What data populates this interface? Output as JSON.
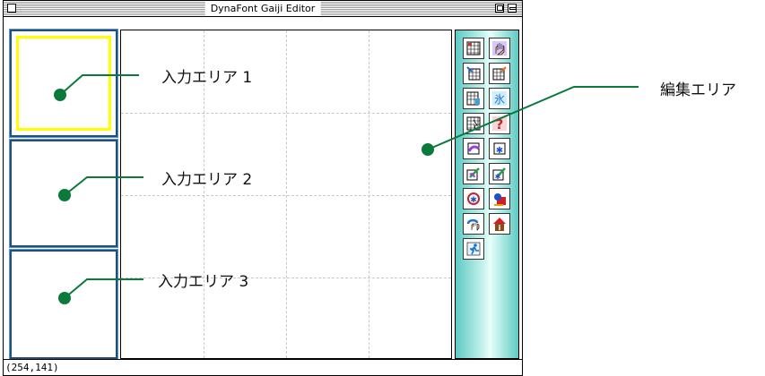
{
  "window": {
    "title": "DynaFont Gaiji Editor"
  },
  "status": {
    "coordinates": "(254,141)"
  },
  "callouts": {
    "input1": "入力エリア 1",
    "input2": "入力エリア 2",
    "input3": "入力エリア 3",
    "edit": "編集エリア"
  },
  "colors": {
    "callout": "#0a7a3b",
    "selection": "#ffff00",
    "panel": "#5fc9c2"
  },
  "tools": [
    "grid-icon",
    "hand-icon",
    "grid-import-icon",
    "grid-export-icon",
    "grid-copy-icon",
    "ice-icon",
    "grid-cursor-icon",
    "help-icon",
    "paste-icon",
    "glyph-icon",
    "edit-icon",
    "glyph-edit-icon",
    "rotate-icon",
    "fill-icon",
    "undo-hand-icon",
    "info-icon",
    "run-icon"
  ]
}
